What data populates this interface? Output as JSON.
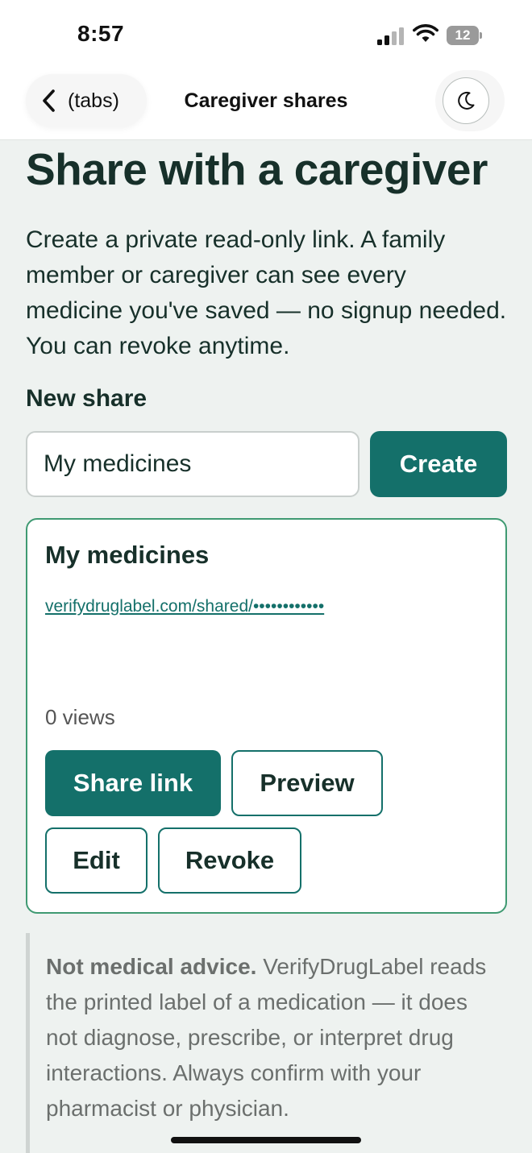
{
  "status_bar": {
    "time": "8:57",
    "battery_level": "12"
  },
  "nav": {
    "back_label": "(tabs)",
    "title": "Caregiver shares"
  },
  "page": {
    "title": "Share with a caregiver",
    "intro": "Create a private read-only link. A family member or caregiver can see every medicine you've saved — no signup needed. You can revoke anytime."
  },
  "new_share": {
    "label": "New share",
    "input_value": "My medicines",
    "create_label": "Create"
  },
  "share_card": {
    "title": "My medicines",
    "link": "verifydruglabel.com/shared/••••••••••••",
    "views": "0 views",
    "share_link_label": "Share link",
    "preview_label": "Preview",
    "edit_label": "Edit",
    "revoke_label": "Revoke"
  },
  "disclaimer": {
    "bold": "Not medical advice.",
    "text": " VerifyDrugLabel reads the printed label of a medication — it does not diagnose, prescribe, or interpret drug interactions. Always confirm with your pharmacist or physician."
  },
  "colors": {
    "accent": "#14706a",
    "card_border": "#3f9a72",
    "background": "#eef2f0",
    "text": "#17302a"
  },
  "icons": {
    "back": "chevron-left-icon",
    "theme": "moon-icon",
    "signal": "cellular-signal-icon",
    "wifi": "wifi-icon",
    "battery": "battery-icon"
  }
}
